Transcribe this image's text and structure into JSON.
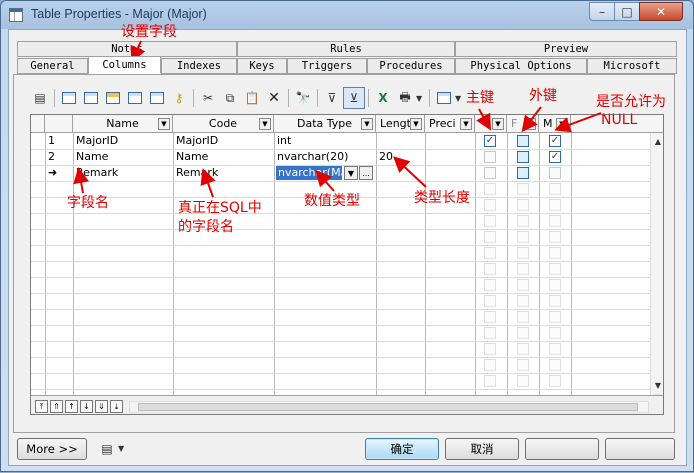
{
  "window": {
    "title": "Table Properties - Major (Major)",
    "minimize_glyph": "–",
    "maximize_glyph": "□",
    "close_glyph": "✕"
  },
  "tabs": {
    "top_row": [
      "Notes",
      "Rules",
      "Preview"
    ],
    "bottom_row": [
      "General",
      "Columns",
      "Indexes",
      "Keys",
      "Triggers",
      "Procedures",
      "Physical Options",
      "Microsoft"
    ],
    "active": "Columns"
  },
  "grid": {
    "headers": [
      "Name",
      "Code",
      "Data Type",
      "Lengt",
      "Preci",
      "",
      "F",
      "M"
    ],
    "rows": [
      {
        "num": "1",
        "name": "MajorID",
        "code": "MajorID",
        "datatype": "int",
        "length": "",
        "primary": true,
        "foreign": false,
        "mandatory": true
      },
      {
        "num": "2",
        "name": "Name",
        "code": "Name",
        "datatype": "nvarchar(20)",
        "length": "20",
        "primary": false,
        "foreign": false,
        "mandatory": true
      },
      {
        "num": "➜",
        "name": "Remark",
        "code": "Remark",
        "datatype": "nvarchar(Max)",
        "length": "",
        "primary": false,
        "foreign": false,
        "mandatory": false
      }
    ],
    "edit_button": "..."
  },
  "buttons": {
    "more": "More >>",
    "ok": "确定",
    "cancel": "取消"
  },
  "annotations": {
    "set_fields": "设置字段",
    "primary_key": "主键",
    "foreign_key": "外键",
    "allow_null_1": "是否允许为",
    "allow_null_2": "NULL",
    "field_name": "字段名",
    "sql_name_1": "真正在SQL中",
    "sql_name_2": "的字段名",
    "data_type": "数值类型",
    "type_length": "类型长度"
  },
  "colors": {
    "annotation": "#e00000",
    "selection": "#3574c6",
    "title_text": "#1e395b"
  }
}
